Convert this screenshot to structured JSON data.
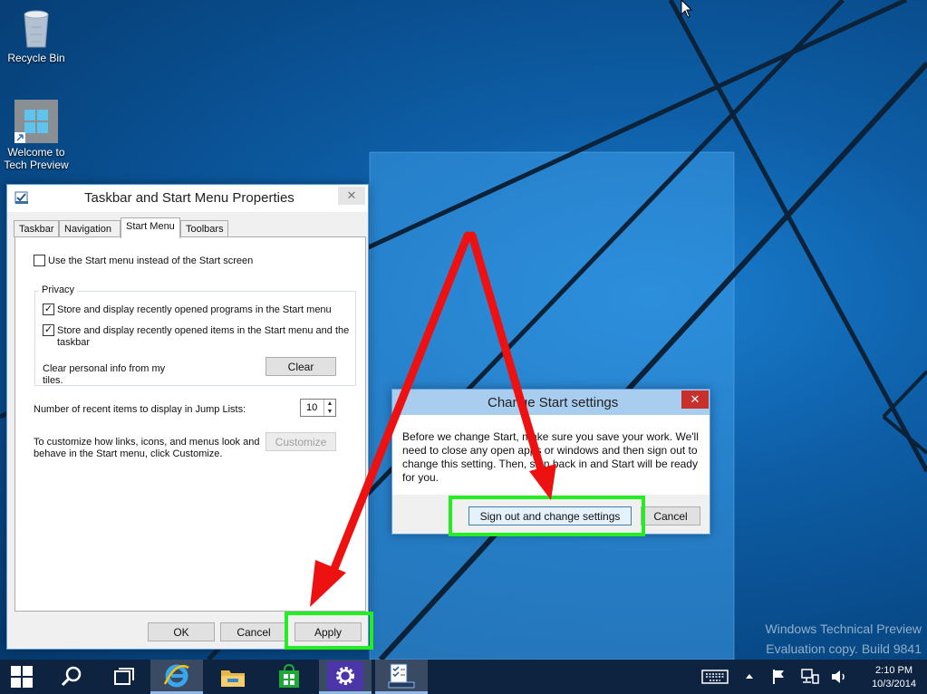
{
  "desktop": {
    "icons": [
      {
        "label": "Recycle Bin",
        "icon": "recycle-bin-icon"
      },
      {
        "label": "Welcome to Tech Preview",
        "icon": "windows-logo-icon"
      }
    ],
    "watermark": {
      "line1": "Windows Technical Preview",
      "line2": "Evaluation copy. Build 9841"
    }
  },
  "properties_dialog": {
    "title": "Taskbar and Start Menu Properties",
    "close_label": "✕",
    "tabs": [
      {
        "label": "Taskbar",
        "active": false
      },
      {
        "label": "Navigation",
        "active": false
      },
      {
        "label": "Start Menu",
        "active": true
      },
      {
        "label": "Toolbars",
        "active": false
      }
    ],
    "use_start_menu": {
      "label": "Use the Start menu instead of the Start screen",
      "checked": false
    },
    "privacy": {
      "title": "Privacy",
      "store_programs": {
        "label": "Store and display recently opened programs in the Start menu",
        "checked": true
      },
      "store_items": {
        "label_line1": "Store and display recently opened items in the Start menu and the",
        "label_line2": "taskbar",
        "checked": true
      },
      "clear_text_line1": "Clear personal info from my",
      "clear_text_line2": "tiles.",
      "clear_button": "Clear"
    },
    "jump_lists": {
      "label": "Number of recent items to display in Jump Lists:",
      "value": "10"
    },
    "customize": {
      "text_line1": "To customize how links, icons, and menus look and",
      "text_line2": "behave in the Start menu, click Customize.",
      "button": "Customize"
    },
    "ok_button": "OK",
    "cancel_button": "Cancel",
    "apply_button": "Apply"
  },
  "change_start_dialog": {
    "title": "Change Start settings",
    "close_label": "✕",
    "message_line1": "Before we change Start, make sure you save your work. We'll",
    "message_line2": "need to close any open apps or windows and then sign out to",
    "message_line3": "change this setting. Then, sign back in and Start will be ready",
    "message_line4": "for you.",
    "sign_out_button": "Sign out and change settings",
    "cancel_button": "Cancel"
  },
  "taskbar": {
    "items": [
      {
        "name": "start-button",
        "icon": "windows-logo-icon"
      },
      {
        "name": "search-button",
        "icon": "search-icon"
      },
      {
        "name": "task-view-button",
        "icon": "task-view-icon"
      },
      {
        "name": "internet-explorer",
        "icon": "internet-explorer-icon"
      },
      {
        "name": "file-explorer",
        "icon": "folder-icon"
      },
      {
        "name": "store",
        "icon": "store-icon"
      },
      {
        "name": "control-panel",
        "icon": "gear-icon"
      },
      {
        "name": "taskbar-properties",
        "icon": "taskbar-properties-icon"
      }
    ],
    "tray": [
      "keyboard-icon",
      "chevron-up-icon",
      "flag-icon",
      "network-icon",
      "volume-icon"
    ],
    "time": "2:10 PM",
    "date": "10/3/2014"
  },
  "colors": {
    "highlight": "#22ee22",
    "arrow": "#ee1111",
    "close_red": "#c7302b",
    "taskbar": "#0e2340"
  }
}
